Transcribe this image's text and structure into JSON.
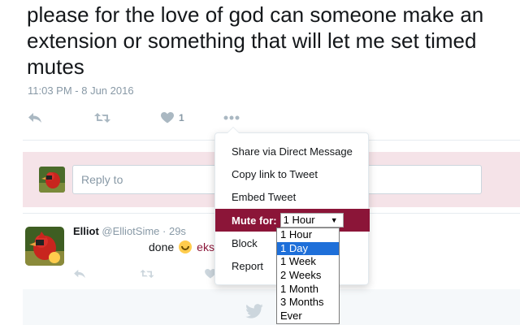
{
  "tweet": {
    "text": "please for the love of god can someone make an extension or something that will let me set timed mutes",
    "timestamp": "11:03 PM - 8 Jun 2016",
    "like_count": "1"
  },
  "reply_box": {
    "placeholder": "Reply to"
  },
  "reply": {
    "name": "Elliot",
    "handle": "@ElliotSime",
    "time": "· 29s",
    "text_before": "done",
    "text_link": "eks"
  },
  "menu": {
    "items": [
      "Share via Direct Message",
      "Copy link to Tweet",
      "Embed Tweet"
    ],
    "mute_label": "Mute for:",
    "mute_selected": "1 Hour",
    "after_items": [
      "Block",
      "Report"
    ]
  },
  "mute_options": [
    "1 Hour",
    "1 Day",
    "1 Week",
    "2 Weeks",
    "1 Month",
    "3 Months",
    "Ever"
  ],
  "highlighted_option": "1 Day",
  "colors": {
    "accent": "#8b1538",
    "reply_background": "#f5e3e8",
    "option_highlight": "#1e6fd9"
  }
}
